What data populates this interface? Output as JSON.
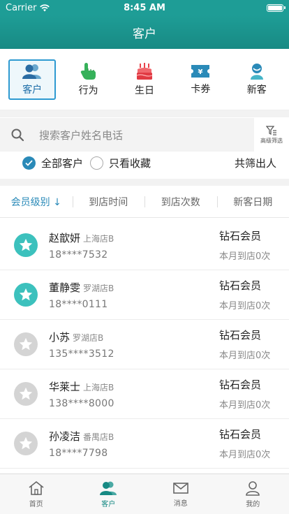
{
  "status_bar": {
    "carrier": "Carrier",
    "time": "8:45 AM"
  },
  "nav": {
    "title": "客户"
  },
  "categories": [
    {
      "label": "客户",
      "icon": "people-icon",
      "active": true
    },
    {
      "label": "行为",
      "icon": "hand-pointer-icon",
      "active": false
    },
    {
      "label": "生日",
      "icon": "cake-icon",
      "active": false
    },
    {
      "label": "卡券",
      "icon": "coupon-icon",
      "active": false
    },
    {
      "label": "新客",
      "icon": "new-customer-icon",
      "active": false
    }
  ],
  "search": {
    "placeholder": "搜索客户姓名电话",
    "filter_label": "高级筛选"
  },
  "options": {
    "all_customers": "全部客户",
    "only_favorites": "只看收藏",
    "filter_summary": "共筛出人"
  },
  "sort_tabs": [
    "会员级别 ↓",
    "到店时间",
    "到店次数",
    "新客日期"
  ],
  "customers": [
    {
      "name": "赵歆妍",
      "store": "上海店B",
      "phone": "18****7532",
      "level": "钻石会员",
      "visits": "本月到店0次"
    },
    {
      "name": "董静雯",
      "store": "罗湖店B",
      "phone": "18****0111",
      "level": "钻石会员",
      "visits": "本月到店0次"
    },
    {
      "name": "小苏",
      "store": "罗湖店B",
      "phone": "135****3512",
      "level": "钻石会员",
      "visits": "本月到店0次"
    },
    {
      "name": "华莱士",
      "store": "上海店B",
      "phone": "138****8000",
      "level": "钻石会员",
      "visits": "本月到店0次"
    },
    {
      "name": "孙凌洁",
      "store": "番禺店B",
      "phone": "18****7798",
      "level": "钻石会员",
      "visits": "本月到店0次"
    }
  ],
  "tabs": [
    {
      "label": "首页",
      "icon": "home-icon"
    },
    {
      "label": "客户",
      "icon": "customer-icon"
    },
    {
      "label": "消息",
      "icon": "mail-icon"
    },
    {
      "label": "我的",
      "icon": "profile-icon"
    }
  ],
  "colors": {
    "brand": "#1e9d96",
    "active_blue": "#2a8ab8",
    "star_teal": "#3cc1bd",
    "star_gray": "#d4d4d4"
  }
}
